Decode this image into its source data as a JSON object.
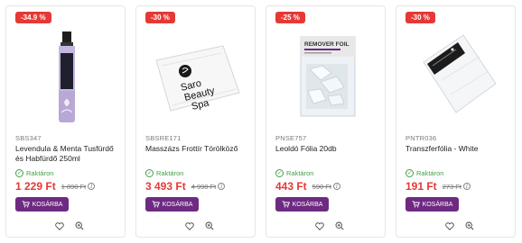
{
  "products": [
    {
      "discount": "-34.9 %",
      "sku": "SBS347",
      "name": "Levendula & Menta Tusfürdő és Habfürdő 250ml",
      "stock": "Raktáron",
      "price": "1 229 Ft",
      "old_price": "1 890 Ft",
      "cart_label": "KOSÁRBA",
      "image": "lavender-bottle"
    },
    {
      "discount": "-30 %",
      "sku": "SBSRE171",
      "name": "Masszázs Frottír Törölköző",
      "stock": "Raktáron",
      "price": "3 493 Ft",
      "old_price": "4 990 Ft",
      "cart_label": "KOSÁRBA",
      "image": "towel",
      "logo_text": [
        "Saro",
        "Beauty",
        "Spa"
      ]
    },
    {
      "discount": "-25 %",
      "sku": "PNSE757",
      "name": "Leoldó Fólia 20db",
      "stock": "Raktáron",
      "price": "443 Ft",
      "old_price": "590 Ft",
      "cart_label": "KOSÁRBA",
      "image": "remover-foil-pack",
      "pack_text": "REMOVER FOIL"
    },
    {
      "discount": "-30 %",
      "sku": "PNTR036",
      "name": "Transzferfólia - White",
      "stock": "Raktáron",
      "price": "191 Ft",
      "old_price": "273 Ft",
      "cart_label": "KOSÁRBA",
      "image": "transfer-foil-pack"
    }
  ],
  "colors": {
    "sale": "#e53935",
    "stock": "#43a047",
    "button": "#6e2a82"
  }
}
